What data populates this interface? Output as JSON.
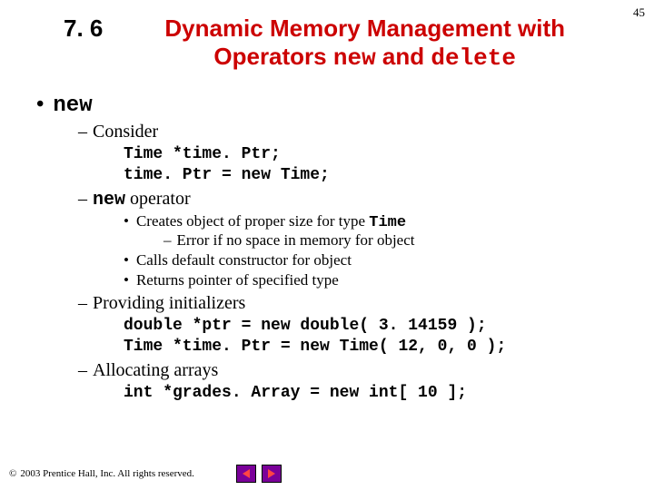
{
  "page_number": "45",
  "heading": {
    "section": "7. 6",
    "line1_pre": "Dynamic Memory Management with",
    "line2_pre": "Operators ",
    "line2_code1": "new",
    "line2_mid": " and ",
    "line2_code2": "delete"
  },
  "b1_new": "new",
  "b2_consider": "Consider",
  "code_consider": "Time *time. Ptr;\ntime. Ptr = new Time;",
  "b2_new_operator_code": "new",
  "b2_new_operator_text": " operator",
  "b3_creates_pre": "Creates object of proper size for type ",
  "b3_creates_code": "Time",
  "b4_error": "Error if no space in memory for object",
  "b3_calls": "Calls default constructor for object",
  "b3_returns": "Returns pointer of specified type",
  "b2_providing": "Providing initializers",
  "code_providing": "double *ptr = new double( 3. 14159 );\nTime *time. Ptr = new Time( 12, 0, 0 );",
  "b2_allocating": "Allocating arrays",
  "code_allocating": "int *grades. Array = new int[ 10 ];",
  "footer": {
    "copyright_symbol": "©",
    "text": "2003 Prentice Hall, Inc.  All rights reserved."
  }
}
